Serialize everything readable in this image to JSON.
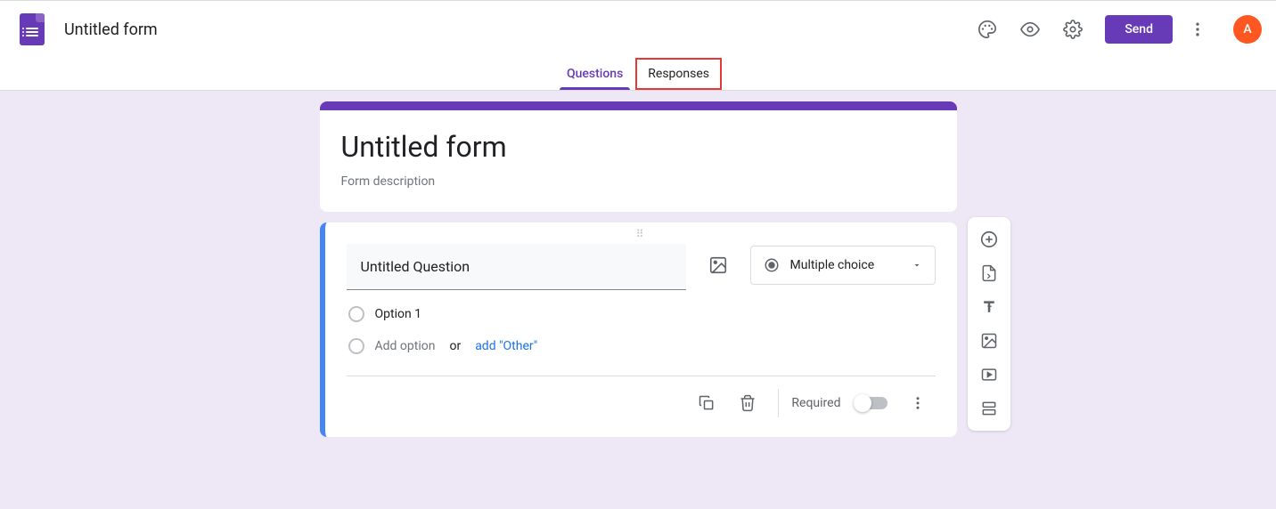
{
  "header": {
    "form_name": "Untitled form",
    "send_label": "Send",
    "avatar_letter": "A"
  },
  "tabs": {
    "questions": "Questions",
    "responses": "Responses"
  },
  "form": {
    "title": "Untitled form",
    "description_placeholder": "Form description"
  },
  "question": {
    "title": "Untitled Question",
    "type_label": "Multiple choice",
    "option1": "Option 1",
    "add_option": "Add option",
    "or": "or",
    "add_other": "add \"Other\"",
    "required_label": "Required"
  }
}
